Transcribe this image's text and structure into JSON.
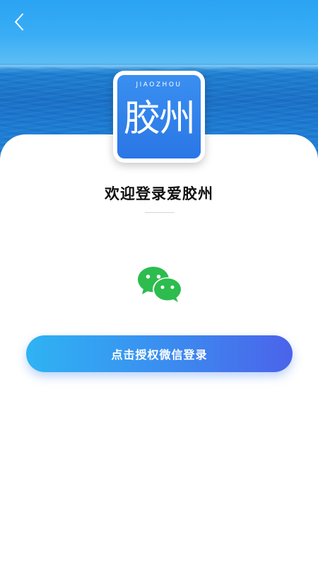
{
  "header": {
    "back_icon": "chevron-left-icon"
  },
  "logo": {
    "english_text": "JIAOZHOU",
    "chinese_text": "胶州",
    "background_color": "#2a7de9"
  },
  "welcome": {
    "title": "欢迎登录爱胶州"
  },
  "wechat": {
    "icon": "wechat-icon",
    "color": "#2dbc4e"
  },
  "login_button": {
    "label": "点击授权微信登录",
    "gradient_start": "#2fb3f3",
    "gradient_end": "#4b63ea"
  }
}
